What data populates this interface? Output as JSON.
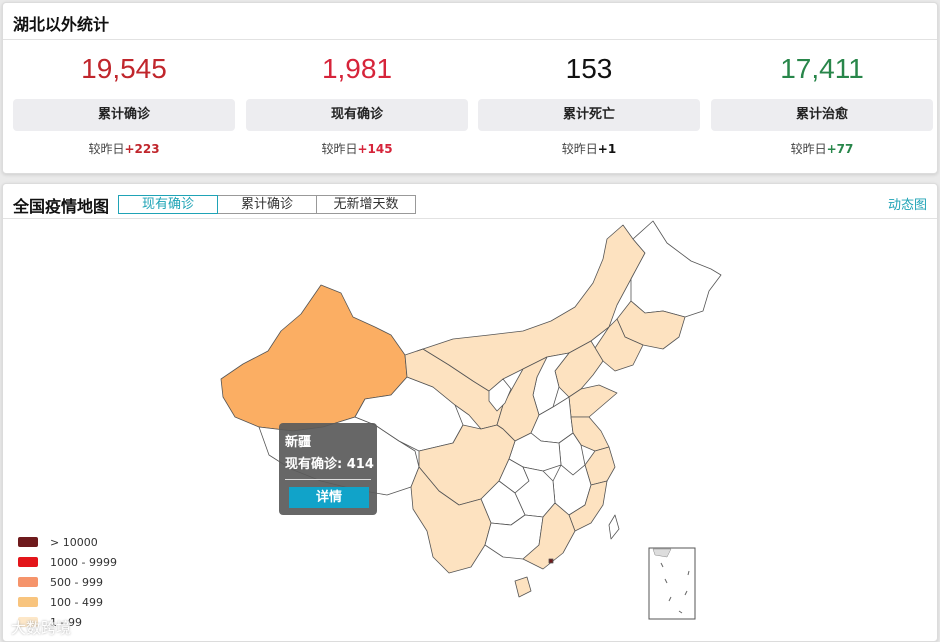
{
  "stats": {
    "title": "湖北以外统计",
    "cards": [
      {
        "number": "19,545",
        "label": "累计确诊",
        "delta_prefix": "较昨日",
        "delta_value": "+223",
        "color": "#c0262c",
        "delta_color": "#c0262c"
      },
      {
        "number": "1,981",
        "label": "现有确诊",
        "delta_prefix": "较昨日",
        "delta_value": "+145",
        "color": "#d6243a",
        "delta_color": "#d6243a"
      },
      {
        "number": "153",
        "label": "累计死亡",
        "delta_prefix": "较昨日",
        "delta_value": "+1",
        "color": "#111111",
        "delta_color": "#111111"
      },
      {
        "number": "17,411",
        "label": "累计治愈",
        "delta_prefix": "较昨日",
        "delta_value": "+77",
        "color": "#28864a",
        "delta_color": "#28864a"
      }
    ]
  },
  "map": {
    "title": "全国疫情地图",
    "tabs": [
      {
        "label": "现有确诊",
        "active": true
      },
      {
        "label": "累计确诊",
        "active": false
      },
      {
        "label": "无新增天数",
        "active": false
      }
    ],
    "animation_link": "动态图",
    "tooltip": {
      "region": "新疆",
      "value_text": "现有确诊: 414",
      "button": "详情"
    },
    "legend": [
      {
        "label": "> 10000",
        "color": "#6e1a1c"
      },
      {
        "label": "1000 - 9999",
        "color": "#e3151a"
      },
      {
        "label": "500 - 999",
        "color": "#f5946b"
      },
      {
        "label": "100 - 499",
        "color": "#f8c47e"
      },
      {
        "label": "1 - 99",
        "color": "#fde7c8"
      }
    ],
    "colors": {
      "highlight": "#fbae63",
      "light": "#fde2c0",
      "none": "#ffffff",
      "border": "#555555"
    }
  },
  "watermark": "大数跨境"
}
